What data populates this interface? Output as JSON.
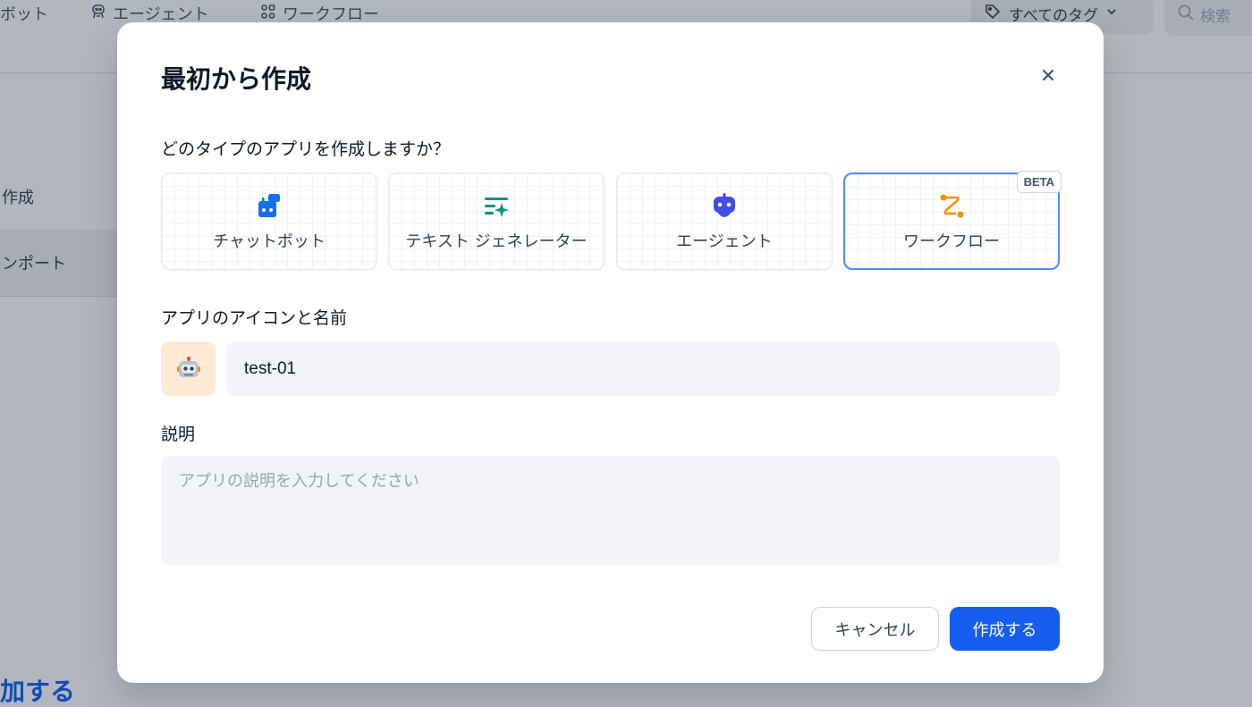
{
  "background": {
    "nav_tabs": [
      {
        "label": "ボット",
        "icon": "chatbot-icon"
      },
      {
        "label": "エージェント",
        "icon": "agent-icon"
      },
      {
        "label": "ワークフロー",
        "icon": "workflow-icon"
      }
    ],
    "tag_filter_label": "すべてのタグ",
    "search_placeholder": "検索",
    "sidebar_items": [
      "作成",
      "ンポート"
    ],
    "add_text": "加する"
  },
  "modal": {
    "title": "最初から作成",
    "question": "どのタイプのアプリを作成しますか？",
    "app_types": [
      {
        "label": "チャットボット",
        "icon": "chatbot-icon",
        "color": "#1570ef",
        "selected": false
      },
      {
        "label": "テキスト ジェネレーター",
        "icon": "text-generator-icon",
        "color": "#0e9384",
        "selected": false
      },
      {
        "label": "エージェント",
        "icon": "agent-icon",
        "color": "#444ce7",
        "selected": false
      },
      {
        "label": "ワークフロー",
        "icon": "workflow-icon",
        "color": "#f79009",
        "selected": true,
        "badge": "BETA"
      }
    ],
    "name_label": "アプリのアイコンと名前",
    "app_icon_emoji": "🤖",
    "app_name_value": "test-01",
    "description_label": "説明",
    "description_placeholder": "アプリの説明を入力してください",
    "cancel_label": "キャンセル",
    "create_label": "作成する"
  },
  "colors": {
    "accent": "#155eef",
    "selected_border": "#528bff",
    "input_bg": "#f2f4f7",
    "icon_bg": "#ffead5"
  }
}
